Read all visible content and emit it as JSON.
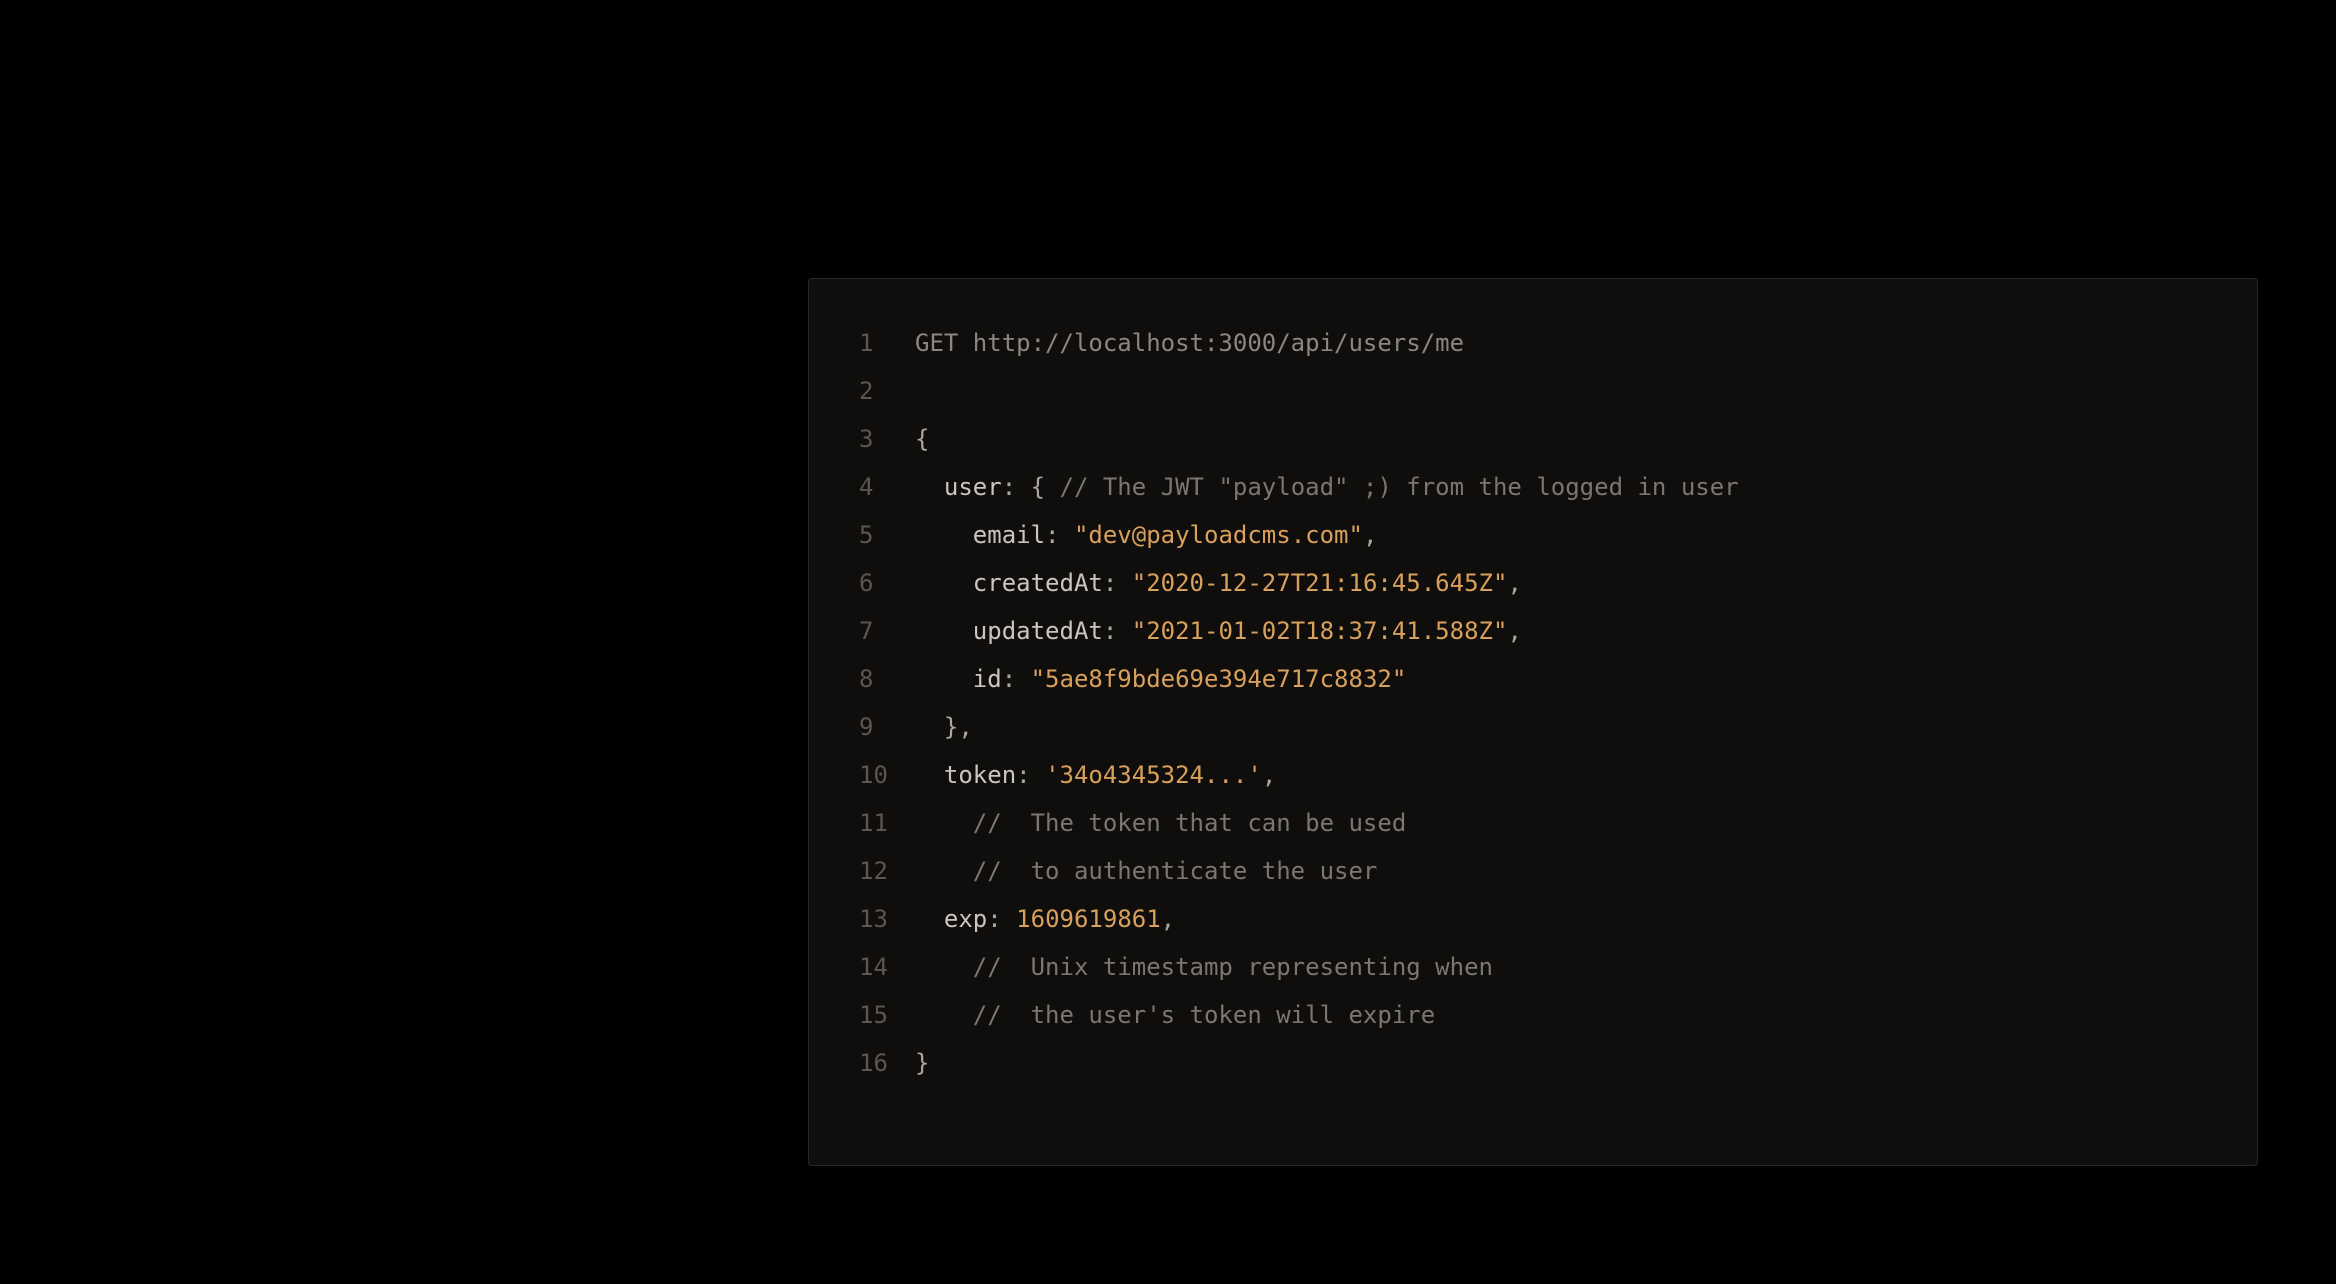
{
  "code": {
    "request_line": "GET http://localhost:3000/api/users/me",
    "brace_open": "{",
    "user_key": "user",
    "user_comment": "// The JWT \"payload\" ;) from the logged in user",
    "email_key": "email",
    "email_value": "\"dev@payloadcms.com\"",
    "createdAt_key": "createdAt",
    "createdAt_value": "\"2020-12-27T21:16:45.645Z\"",
    "updatedAt_key": "updatedAt",
    "updatedAt_value": "\"2021-01-02T18:37:41.588Z\"",
    "id_key": "id",
    "id_value": "\"5ae8f9bde69e394e717c8832\"",
    "user_close": "},",
    "token_key": "token",
    "token_value": "'34o4345324...'",
    "token_comment1": "//  The token that can be used",
    "token_comment2": "//  to authenticate the user",
    "exp_key": "exp",
    "exp_value": "1609619861",
    "exp_comment1": "//  Unix timestamp representing when",
    "exp_comment2": "//  the user's token will expire",
    "brace_close": "}",
    "line_numbers": [
      "1",
      "2",
      "3",
      "4",
      "5",
      "6",
      "7",
      "8",
      "9",
      "10",
      "11",
      "12",
      "13",
      "14",
      "15",
      "16"
    ]
  }
}
